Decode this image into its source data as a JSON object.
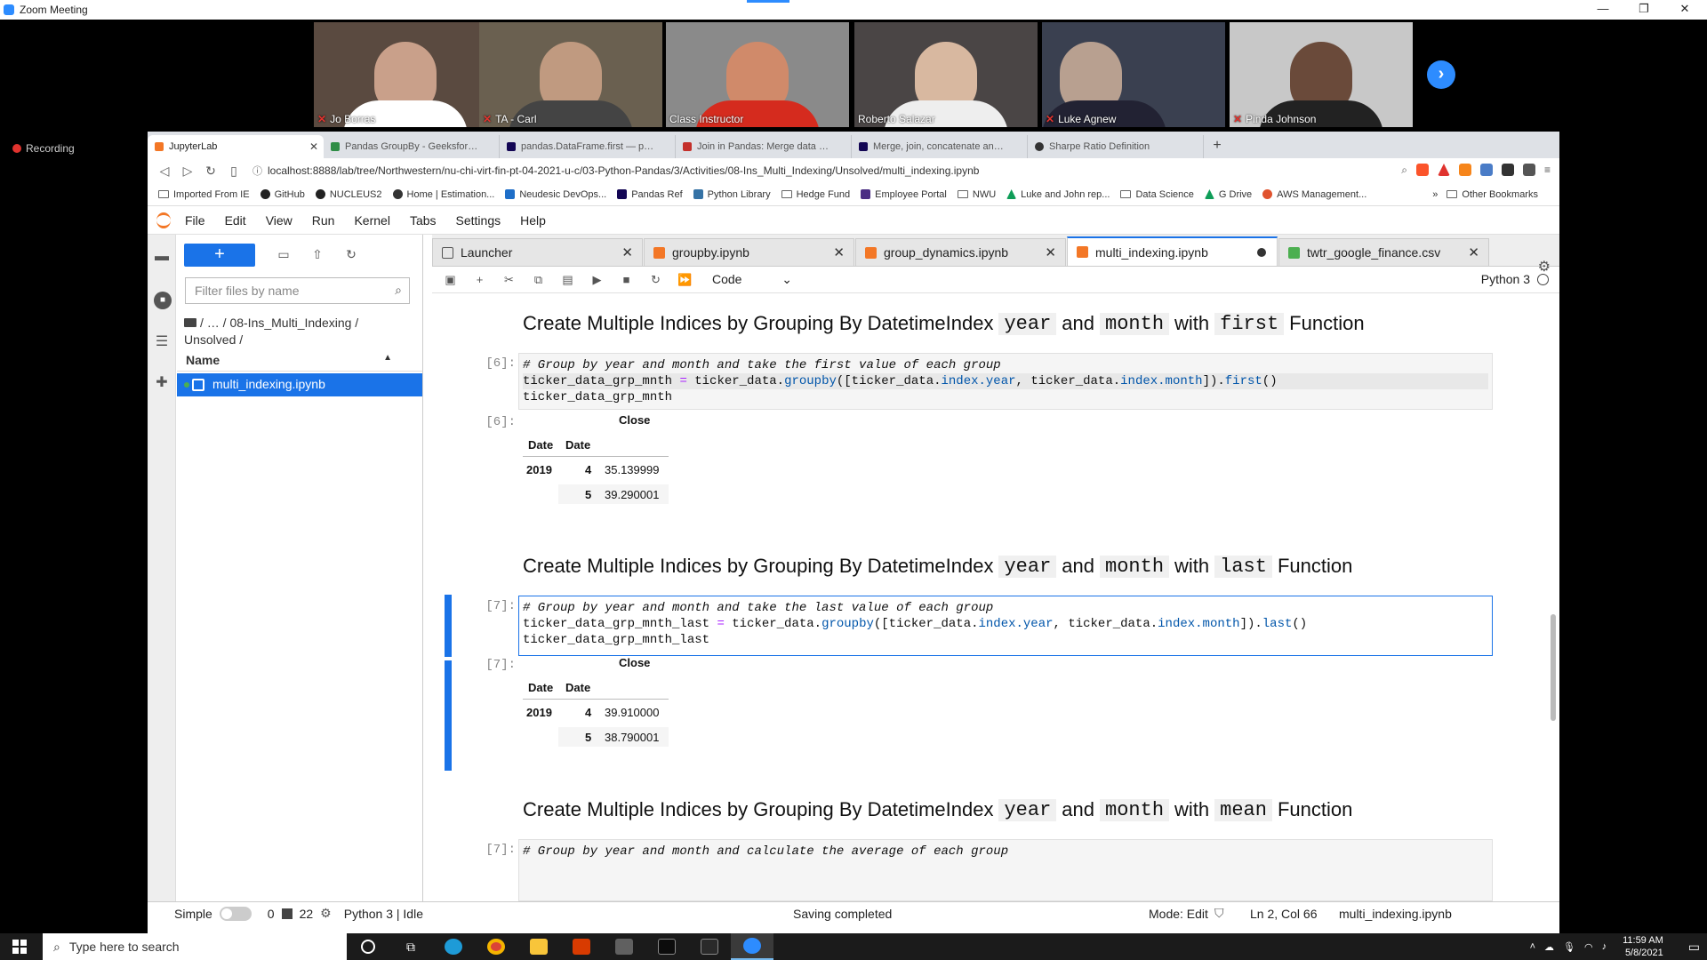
{
  "zoom": {
    "title": "Zoom Meeting",
    "recording": "Recording",
    "participants": [
      {
        "name": "Jo Borras",
        "muted": true,
        "bg": "#5a4a40"
      },
      {
        "name": "TA - Carl",
        "muted": true,
        "bg": "#6a6050"
      },
      {
        "name": "Class Instructor",
        "muted": false,
        "bg": "#8a8a8a"
      },
      {
        "name": "Roberto Salazar",
        "muted": false,
        "bg": "#4a4545"
      },
      {
        "name": "Luke Agnew",
        "muted": true,
        "bg": "#3a4050"
      },
      {
        "name": "Pinda Johnson",
        "muted": true,
        "bg": "#c8c8c8"
      }
    ]
  },
  "browser": {
    "tabs": [
      {
        "title": "JupyterLab",
        "color": "#f37726"
      },
      {
        "title": "Pandas GroupBy - GeeksforGeeks",
        "color": "#2f8d46"
      },
      {
        "title": "pandas.DataFrame.first — pandas",
        "color": "#130654"
      },
      {
        "title": "Join in Pandas: Merge data frames",
        "color": "#c4302b"
      },
      {
        "title": "Merge, join, concatenate and comp",
        "color": "#130654"
      },
      {
        "title": "Sharpe Ratio Definition",
        "color": "#333333"
      }
    ],
    "url": "localhost:8888/lab/tree/Northwestern/nu-chi-virt-fin-pt-04-2021-u-c/03-Python-Pandas/3/Activities/08-Ins_Multi_Indexing/Unsolved/multi_indexing.ipynb",
    "bookmarks": [
      "Imported From IE",
      "GitHub",
      "NUCLEUS2",
      "Home | Estimation...",
      "Neudesic DevOps...",
      "Pandas Ref",
      "Python Library",
      "Hedge Fund",
      "Employee Portal",
      "NWU",
      "Luke and John rep...",
      "Data Science",
      "G Drive",
      "AWS Management..."
    ],
    "other_bookmarks": "Other Bookmarks"
  },
  "jupyter": {
    "menu": [
      "File",
      "Edit",
      "View",
      "Run",
      "Kernel",
      "Tabs",
      "Settings",
      "Help"
    ],
    "filter_placeholder": "Filter files by name",
    "breadcrumb": "/ … / 08-Ins_Multi_Indexing / Unsolved /",
    "name_header": "Name",
    "file": "multi_indexing.ipynb",
    "doc_tabs": [
      {
        "title": "Launcher",
        "color": "#555555"
      },
      {
        "title": "groupby.ipynb",
        "color": "#f37726"
      },
      {
        "title": "group_dynamics.ipynb",
        "color": "#f37726"
      },
      {
        "title": "multi_indexing.ipynb",
        "color": "#f37726"
      },
      {
        "title": "twtr_google_finance.csv",
        "color": "#4caf50"
      }
    ],
    "cell_type": "Code",
    "kernel": "Python 3",
    "notebook": {
      "h1": {
        "pre": "Create Multiple Indices by Grouping By DatetimeIndex",
        "c1": "year",
        "and": "and",
        "c2": "month",
        "with": "with",
        "c3": "first",
        "post": "Function"
      },
      "h2": {
        "pre": "Create Multiple Indices by Grouping By DatetimeIndex",
        "c1": "year",
        "and": "and",
        "c2": "month",
        "with": "with",
        "c3": "last",
        "post": "Function"
      },
      "h3": {
        "pre": "Create Multiple Indices by Grouping By DatetimeIndex",
        "c1": "year",
        "and": "and",
        "c2": "month",
        "with": "with",
        "c3": "mean",
        "post": "Function"
      },
      "p6": "[6]:",
      "p7": "[7]:",
      "cell6": {
        "comment": "# Group by year and month and take the first value of each group",
        "l2a": "ticker_data_grp_mnth ",
        "eq": "=",
        "l2b": " ticker_data.",
        "fn": "groupby",
        "l2c": "([ticker_data.",
        "a1": "index.year",
        "l2d": ", ticker_data.",
        "a2": "index.month",
        "l2e": "]).",
        "fn2": "first",
        "l2f": "()",
        "l3": "ticker_data_grp_mnth"
      },
      "cell7": {
        "comment": "# Group by year and month and take the last value of each group",
        "l2a": "ticker_data_grp_mnth_last ",
        "eq": "=",
        "l2b": " ticker_data.",
        "fn": "groupby",
        "l2c": "([ticker_data.",
        "a1": "index.year",
        "l2d": ", ticker_data.",
        "a2": "index.month",
        "l2e": "]).",
        "fn2": "last",
        "l2f": "()",
        "l3": "ticker_data_grp_mnth_last"
      },
      "cell8_comment": "# Group by year and month and calculate the average of each group",
      "out6": {
        "col": "Close",
        "idx1": "Date",
        "idx2": "Date",
        "year": "2019",
        "rows": [
          {
            "m": "4",
            "v": "35.139999"
          },
          {
            "m": "5",
            "v": "39.290001"
          }
        ]
      },
      "out7": {
        "col": "Close",
        "idx1": "Date",
        "idx2": "Date",
        "year": "2019",
        "rows": [
          {
            "m": "4",
            "v": "39.910000"
          },
          {
            "m": "5",
            "v": "38.790001"
          }
        ]
      }
    },
    "status": {
      "simple": "Simple",
      "count1": "0",
      "count2": "22",
      "kernel": "Python 3 | Idle",
      "saving": "Saving completed",
      "mode": "Mode: Edit",
      "pos": "Ln 2, Col 66",
      "file": "multi_indexing.ipynb"
    }
  },
  "taskbar": {
    "search": "Type here to search",
    "time": "11:59 AM",
    "date": "5/8/2021"
  }
}
